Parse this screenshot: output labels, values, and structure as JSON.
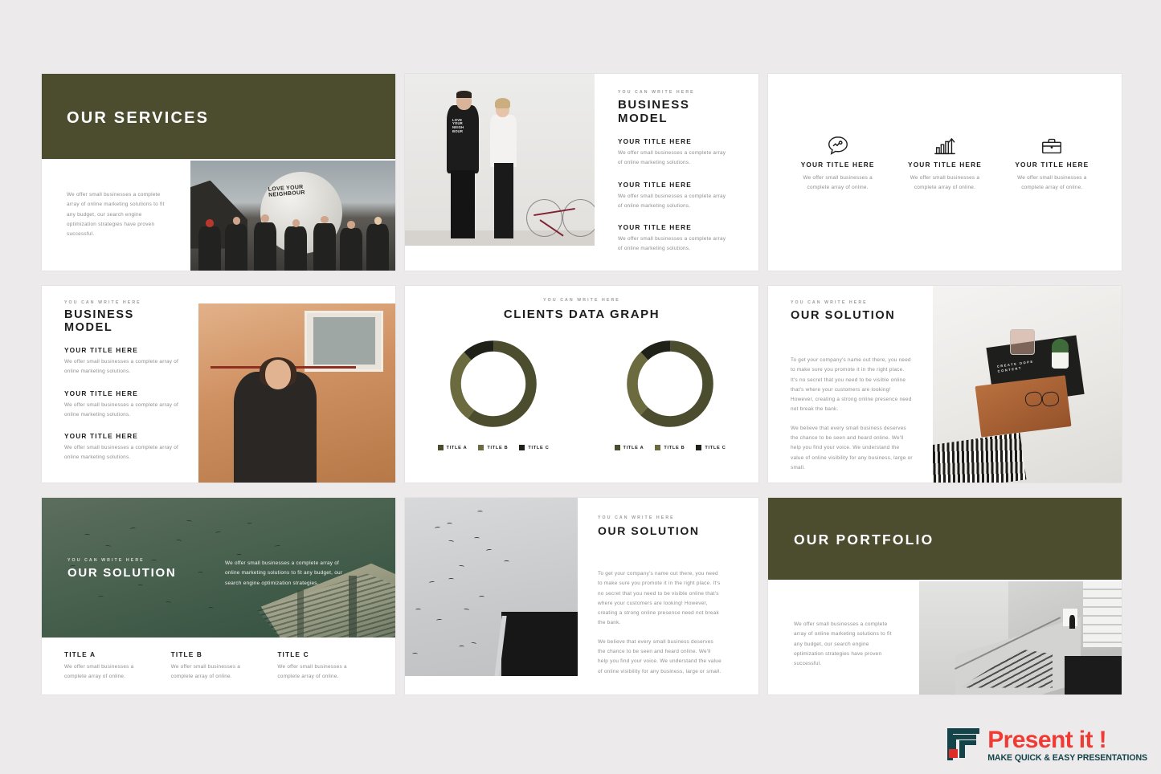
{
  "theme": {
    "page_bg": "#edeaeb",
    "olive": "#4c4c2e",
    "olive_light": "#6b6b3f",
    "near_black": "#1f2018",
    "ink": "#1d1d1d",
    "muted": "#8d8d8d"
  },
  "common": {
    "eyebrow": "YOU CAN WRITE HERE",
    "title_here": "YOUR TITLE HERE",
    "short_body": "We offer small businesses a complete array of online marketing solutions.",
    "short_body_2": "We offer small businesses a complete array of online.",
    "long_body": "We offer small businesses a complete array of online marketing solutions to fit any budget, our search engine optimization strategies have proven successful.",
    "hero_body": "We offer small businesses a complete array of online marketing solutions to fit any budget, our search engine optimization strategies.",
    "solution_p1": "To get your company's name out there, you need to make sure you promote it in the right place. It's no secret that you need to be visible online that's where your customers are looking! However, creating a strong online presence need not break the bank.",
    "solution_p2": "We believe that every small business deserves the chance to be seen and heard online. We'll help you find your voice. We understand the value of online visibility for any business, large or small."
  },
  "slides": [
    {
      "id": "our-services",
      "title": "OUR SERVICES",
      "body": "We offer small businesses a complete array of online marketing solutions to fit any budget, our search engine optimization strategies have proven successful.",
      "photo": "beach-crowd-giant-ball-photo",
      "photo_text": "LOVE YOUR NEIGHBOUR"
    },
    {
      "id": "business-model-photo-left",
      "eyebrow": "YOU CAN WRITE HERE",
      "title": "BUSINESS MODEL",
      "photo": "couple-with-bicycle-photo",
      "items": [
        {
          "title": "YOUR TITLE HERE",
          "body": "We offer small businesses a complete array of online marketing solutions."
        },
        {
          "title": "YOUR TITLE HERE",
          "body": "We offer small businesses a complete array of online marketing solutions."
        },
        {
          "title": "YOUR TITLE HERE",
          "body": "We offer small businesses a complete array of online marketing solutions."
        }
      ]
    },
    {
      "id": "icon-trio",
      "items": [
        {
          "icon": "speech-bubble-chart-icon",
          "title": "YOUR TITLE HERE",
          "body": "We offer small businesses a complete array of online."
        },
        {
          "icon": "bar-chart-growth-icon",
          "title": "YOUR TITLE HERE",
          "body": "We offer small businesses a complete array of online."
        },
        {
          "icon": "briefcase-icon",
          "title": "YOUR TITLE HERE",
          "body": "We offer small businesses a complete array of online."
        }
      ]
    },
    {
      "id": "business-model-photo-right",
      "eyebrow": "YOU CAN WRITE HERE",
      "title": "BUSINESS MODEL",
      "photo": "woman-in-coat-orange-wall-photo",
      "items": [
        {
          "title": "YOUR TITLE HERE",
          "body": "We offer small businesses a complete array of online marketing solutions."
        },
        {
          "title": "YOUR TITLE HERE",
          "body": "We offer small businesses a complete array of online marketing solutions."
        },
        {
          "title": "YOUR TITLE HERE",
          "body": "We offer small businesses a complete array of online marketing solutions."
        }
      ]
    },
    {
      "id": "clients-data-graph",
      "eyebrow": "YOU CAN WRITE HERE",
      "title": "CLIENTS DATA GRAPH"
    },
    {
      "id": "our-solution-desk",
      "eyebrow": "YOU CAN WRITE HERE",
      "title": "OUR SOLUTION",
      "photo": "marble-desk-flatlay-photo",
      "photo_text": "CREATE DOPE CONTENT"
    },
    {
      "id": "our-solution-hero",
      "eyebrow": "YOU CAN WRITE HERE",
      "title": "OUR SOLUTION",
      "photo": "green-tinted-birds-architecture-photo",
      "hero_body": "We offer small businesses a complete array of online marketing solutions to fit any budget, our search engine optimization strategies.",
      "columns": [
        {
          "title": "TITLE A",
          "body": "We offer small businesses a complete array of online."
        },
        {
          "title": "TITLE B",
          "body": "We offer small businesses a complete array of online."
        },
        {
          "title": "TITLE C",
          "body": "We offer small businesses a complete array of online."
        }
      ]
    },
    {
      "id": "our-solution-birds",
      "eyebrow": "YOU CAN WRITE HERE",
      "title": "OUR SOLUTION",
      "photo": "birds-in-sky-doorway-photo"
    },
    {
      "id": "our-portfolio",
      "title": "OUR PORTFOLIO",
      "body": "We offer small businesses a complete array of online marketing solutions to fit any budget, our search engine optimization strategies have proven successful.",
      "photo": "concrete-staircase-photo"
    }
  ],
  "chart_data": [
    {
      "type": "pie",
      "variant": "donut",
      "name": "clients-donut-left",
      "title": "CLIENTS DATA GRAPH",
      "subtitle": "YOU CAN WRITE HERE",
      "labels": [
        "TITLE A",
        "TITLE B",
        "TITLE C"
      ],
      "values": [
        60,
        28,
        12
      ],
      "colors": [
        "#4c4c2e",
        "#6b6b3f",
        "#1f2018"
      ],
      "legend_position": "bottom",
      "start_angle": 0
    },
    {
      "type": "pie",
      "variant": "donut",
      "name": "clients-donut-right",
      "title": "CLIENTS DATA GRAPH",
      "subtitle": "YOU CAN WRITE HERE",
      "labels": [
        "TITLE A",
        "TITLE B",
        "TITLE C"
      ],
      "values": [
        62,
        26,
        12
      ],
      "colors": [
        "#4c4c2e",
        "#6b6b3f",
        "#1f2018"
      ],
      "legend_position": "bottom",
      "start_angle": 0
    }
  ],
  "brand": {
    "name": "Present it !",
    "tagline": "MAKE QUICK & EASY PRESENTATIONS",
    "mark": "nested-corner-bars-logo-mark",
    "red": "#ef3b33",
    "teal": "#14444a"
  }
}
